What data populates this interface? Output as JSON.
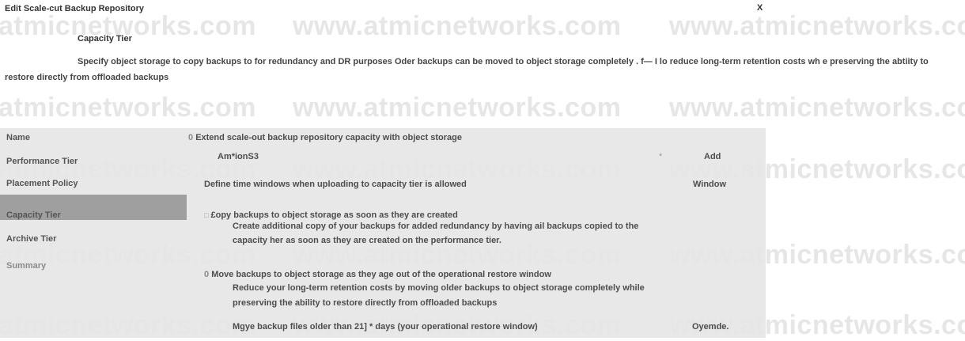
{
  "window": {
    "title": "Edit Scale-cut Backup Repository",
    "close_label": "X"
  },
  "page": {
    "heading": "Capacity Tier",
    "description": "Specify object storage to copy backups to for redundancy and DR purposes Oder backups can be moved to object storage completely . f— I lo reduce long-term retention costs wh e preserving the abtiity to restore directly from offloaded backups"
  },
  "watermark": "www.atmicnetworks.com",
  "watermark_fragment_left": "atmicnetworks.com",
  "sidebar": {
    "items": [
      {
        "label": "Name"
      },
      {
        "label": "Performance Tier"
      },
      {
        "label": "Placement Policy"
      },
      {
        "label": "Capacity Tier"
      },
      {
        "label": "Archive Tier"
      },
      {
        "label": "Summary"
      }
    ]
  },
  "content": {
    "extend": {
      "radio": "0",
      "label": "Extend scale-out backup repository capacity with object storage"
    },
    "repo": {
      "value": "Am*ionS3",
      "dropdown": "*",
      "add_label": "Add"
    },
    "windows": {
      "label": "Define time windows when uploading to capacity tier is allowed",
      "button_label": "Window"
    },
    "copy": {
      "checkbox": "□",
      "label": "£opy backups to object storage as soon as they are created",
      "description_line1": "Create additional copy of your backups for added redundancy by having ail backups copied to the",
      "description_line2": "capacity her as soon as they are created on the performance tier."
    },
    "move": {
      "radio": "0",
      "label": "Move backups to object storage as they age out of the operational restore window",
      "description_line1": "Reduce your long-term retention costs by moving older backups to object storage completely while",
      "description_line2": "preserving the ability to restore directly from offloaded backups"
    },
    "age": {
      "prefix": "Mgye backup files older than",
      "days_value": "21]",
      "suffix": "* days (your operational restore window)",
      "override_label": "Oyemde."
    }
  }
}
